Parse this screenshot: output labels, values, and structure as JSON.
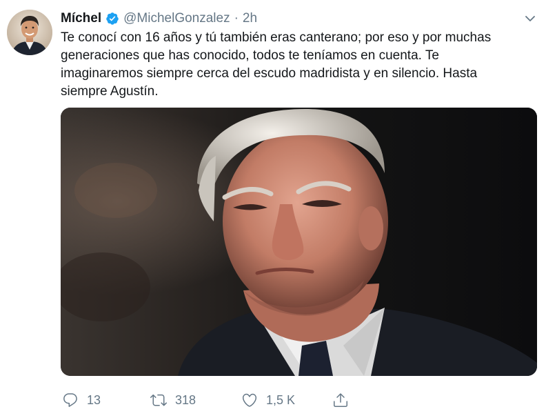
{
  "tweet": {
    "author": {
      "name": "Míchel",
      "verified": true,
      "handle": "@MichelGonzalez"
    },
    "separator": "·",
    "time": "2h",
    "text_lines": [
      "Te conocí con 16 años y tú también eras canterano; por eso y por muchas",
      "generaciones que has conocido, todos te teníamos en cuenta. Te",
      "imaginaremos siempre cerca del escudo madridista y en silencio. Hasta",
      "siempre Agustín."
    ],
    "actions": {
      "replies": "13",
      "retweets": "318",
      "likes": "1,5 K"
    }
  },
  "icons": {
    "verified": "verified-badge-icon",
    "more": "chevron-down-icon",
    "reply": "reply-icon",
    "retweet": "retweet-icon",
    "like": "heart-icon",
    "share": "share-icon"
  },
  "colors": {
    "accent": "#1da1f2",
    "secondary_text": "#657786",
    "primary_text": "#14171a"
  }
}
